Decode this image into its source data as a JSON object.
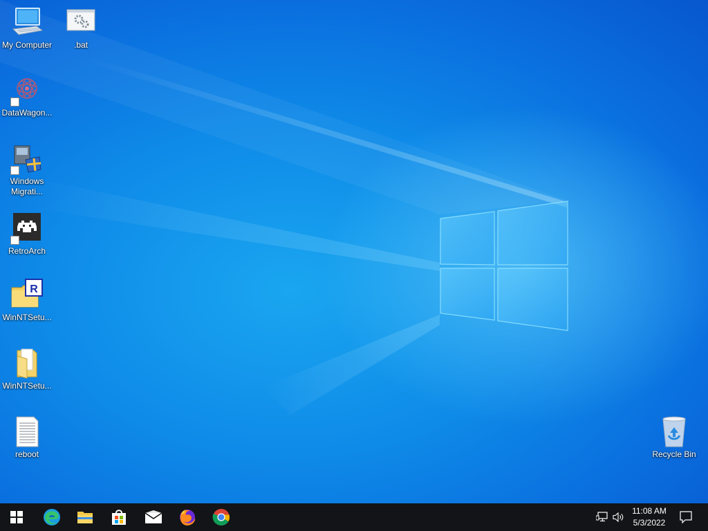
{
  "desktop": {
    "icons": [
      {
        "label": "My Computer",
        "icon": "computer-icon"
      },
      {
        "label": ".bat",
        "icon": "batch-file-icon"
      },
      {
        "label": "DataWagon...",
        "icon": "datawagon-icon"
      },
      {
        "label": "Windows\nMigrati...",
        "icon": "windows-migration-icon"
      },
      {
        "label": "RetroArch",
        "icon": "retroarch-icon"
      },
      {
        "label": "WinNTSetu...",
        "icon": "winntsetup-icon"
      },
      {
        "label": "WinNTSetu...",
        "icon": "folder-icon"
      },
      {
        "label": "reboot",
        "icon": "text-file-icon"
      },
      {
        "label": "Recycle Bin",
        "icon": "recycle-bin-icon"
      }
    ]
  },
  "taskbar": {
    "buttons": [
      {
        "icon": "windows-start-icon"
      },
      {
        "icon": "edge-icon"
      },
      {
        "icon": "file-explorer-icon"
      },
      {
        "icon": "microsoft-store-icon"
      },
      {
        "icon": "mail-icon"
      },
      {
        "icon": "firefox-icon"
      },
      {
        "icon": "chrome-icon"
      }
    ],
    "tray": {
      "network_icon": "network-icon",
      "volume_icon": "volume-icon",
      "time": "11:08 AM",
      "date": "5/3/2022",
      "notification_icon": "action-center-icon"
    }
  },
  "colors": {
    "taskbar": "#121417",
    "wallpaper_light": "#1aa6f0",
    "wallpaper_dark": "#0754cc"
  }
}
